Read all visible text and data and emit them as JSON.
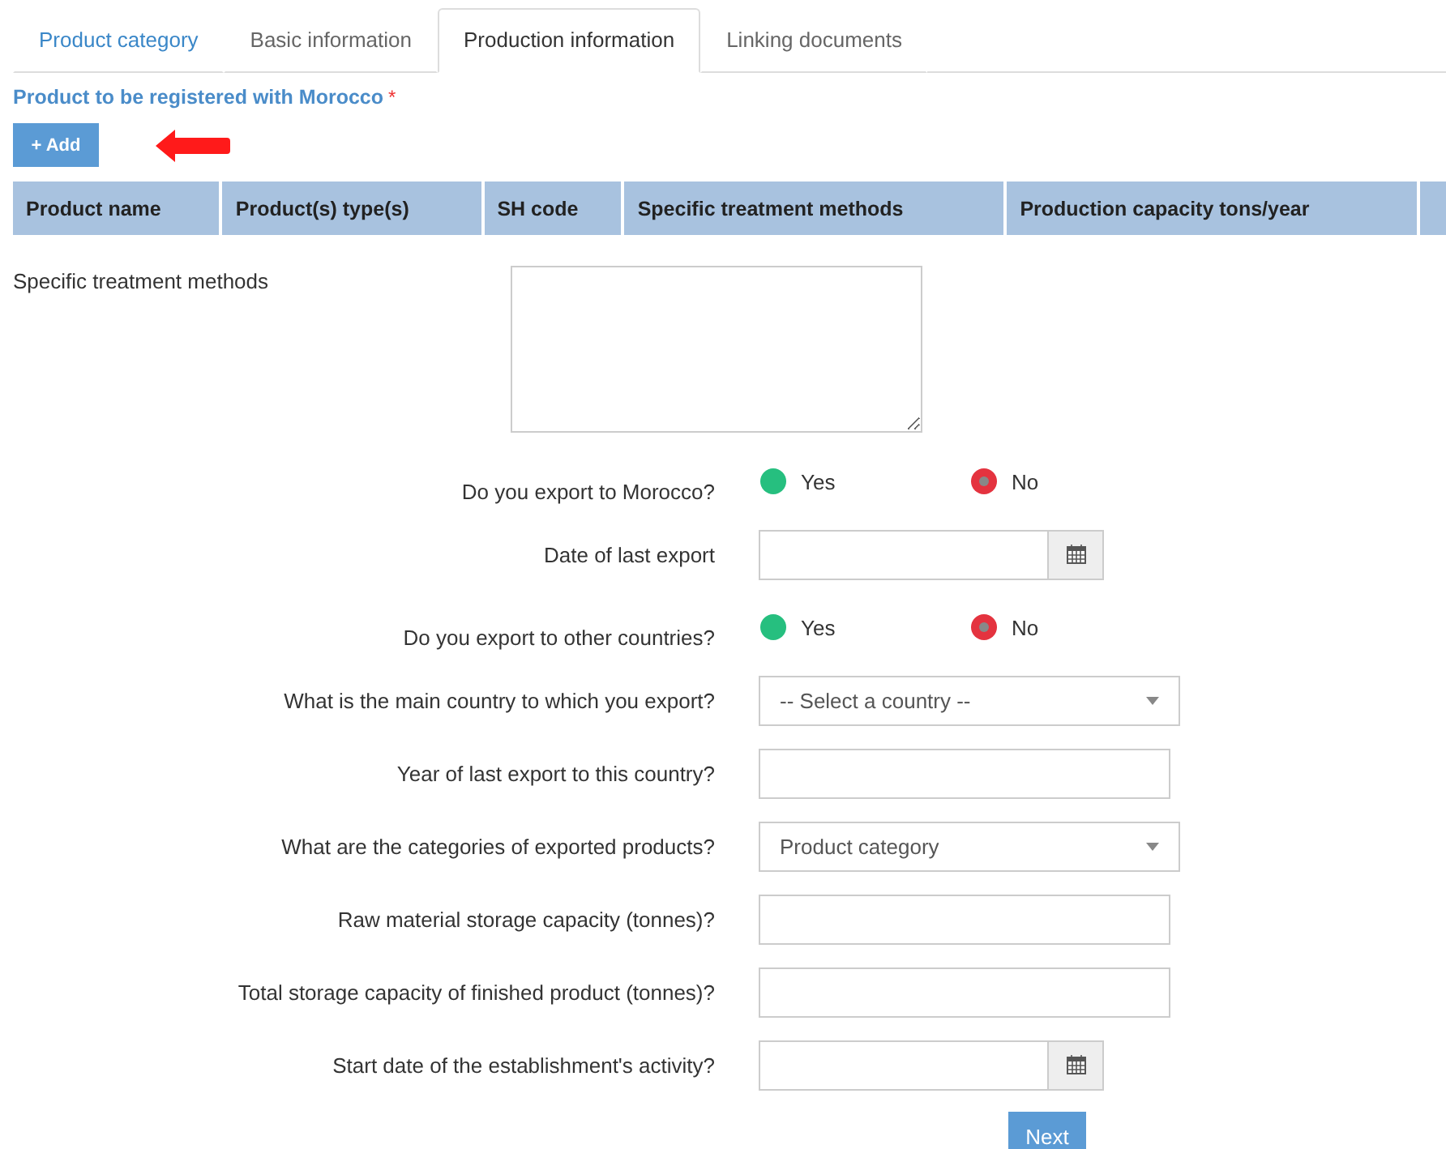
{
  "tabs": [
    {
      "label": "Product category",
      "selected": false
    },
    {
      "label": "Basic information",
      "selected": false
    },
    {
      "label": "Production information",
      "selected": true
    },
    {
      "label": "Linking documents",
      "selected": false
    }
  ],
  "section_title": "Product to be registered with Morocco",
  "required_mark": "*",
  "add_button": {
    "icon": "+",
    "label": "Add"
  },
  "table": {
    "columns": [
      "Product name",
      "Product(s) type(s)",
      "SH code",
      "Specific treatment methods",
      "Production capacity tons/year"
    ]
  },
  "treatment": {
    "label": "Specific treatment methods"
  },
  "fields": [
    {
      "kind": "radio",
      "label": "Do you export to Morocco?",
      "options": [
        {
          "label": "Yes",
          "selected": false,
          "color": "#26bf7f"
        },
        {
          "label": "No",
          "selected": true,
          "color": "#e4333f"
        }
      ]
    },
    {
      "kind": "date",
      "label": "Date of last export"
    },
    {
      "kind": "radio",
      "label": "Do you export to other countries?",
      "options": [
        {
          "label": "Yes",
          "selected": false,
          "color": "#26bf7f"
        },
        {
          "label": "No",
          "selected": true,
          "color": "#e4333f"
        }
      ]
    },
    {
      "kind": "select",
      "label": "What is the main country to which you export?",
      "value": "-- Select a country --"
    },
    {
      "kind": "text",
      "label": "Year of last export to this country?"
    },
    {
      "kind": "select",
      "label": "What are the categories of exported products?",
      "value": "Product category"
    },
    {
      "kind": "text",
      "label": "Raw material storage capacity (tonnes)?"
    },
    {
      "kind": "text",
      "label": "Total storage capacity of finished product (tonnes)?"
    },
    {
      "kind": "date",
      "label": "Start date of the establishment's activity?"
    }
  ],
  "next_button": "Next"
}
